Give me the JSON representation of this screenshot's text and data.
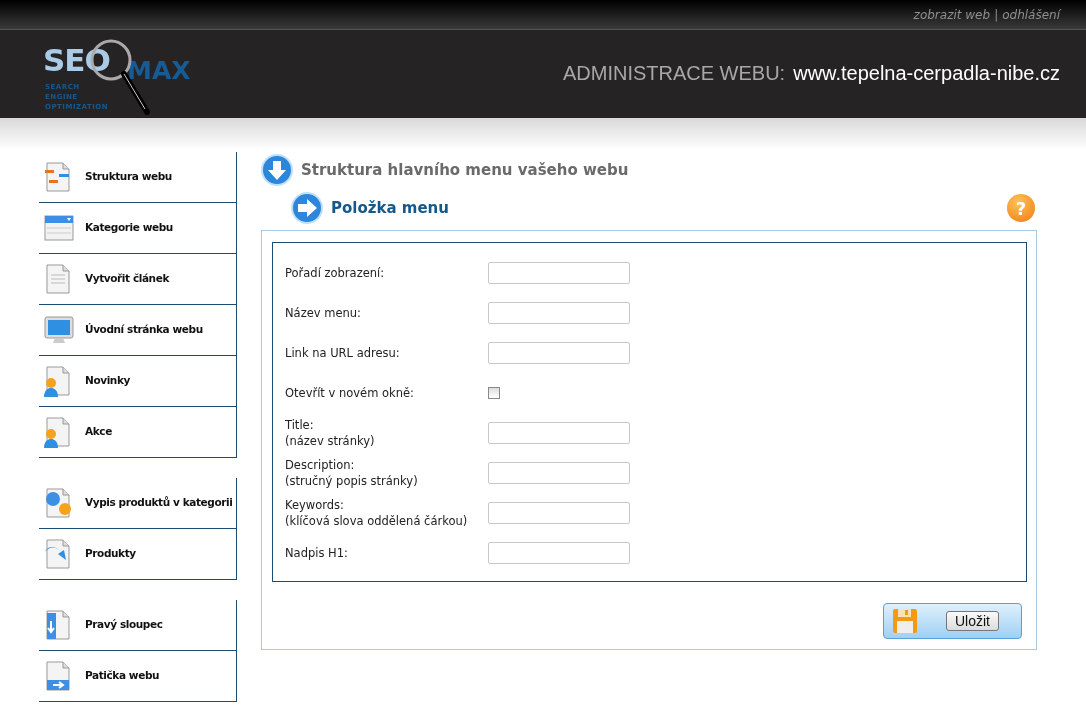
{
  "top_links": {
    "items": [
      "zobrazit web",
      "odhlášení"
    ],
    "separator": "|"
  },
  "logo": {
    "primary": "SEO",
    "secondary": "MAX",
    "tagline": [
      "SEARCH",
      "ENGINE",
      "OPTIMIZATION"
    ]
  },
  "header": {
    "label": "ADMINISTRACE WEBU:",
    "site": "www.tepelna-cerpadla-nibe.cz"
  },
  "sidebar": {
    "groups": [
      {
        "items": [
          "Struktura webu",
          "Kategorie webu",
          "Vytvořit článek",
          "Úvodní stránka webu",
          "Novinky",
          "Akce"
        ]
      },
      {
        "items": [
          "Vypis produktů v kategorii",
          "Produkty"
        ]
      },
      {
        "items": [
          "Pravý sloupec",
          "Patička webu"
        ]
      }
    ]
  },
  "page_title": "Struktura hlavního menu vašeho webu",
  "section_title": "Položka menu",
  "help_symbol": "?",
  "form": {
    "fields": [
      {
        "kind": "text",
        "label": "Pořadí zobrazení:"
      },
      {
        "kind": "text",
        "label": "Název menu:"
      },
      {
        "kind": "text",
        "label": "Link na URL adresu:"
      },
      {
        "kind": "checkbox",
        "label": "Otevřít v novém okně:",
        "checked": false
      },
      {
        "kind": "text",
        "label": "Title:",
        "hint": "(název stránky)"
      },
      {
        "kind": "text",
        "label": "Description:",
        "hint": "(stručný popis stránky)"
      },
      {
        "kind": "text",
        "label": "Keywords:",
        "hint": "(klíčová slova oddělená čárkou)"
      },
      {
        "kind": "text",
        "label": "Nadpis H1:"
      }
    ],
    "save_button": "Uložit"
  }
}
